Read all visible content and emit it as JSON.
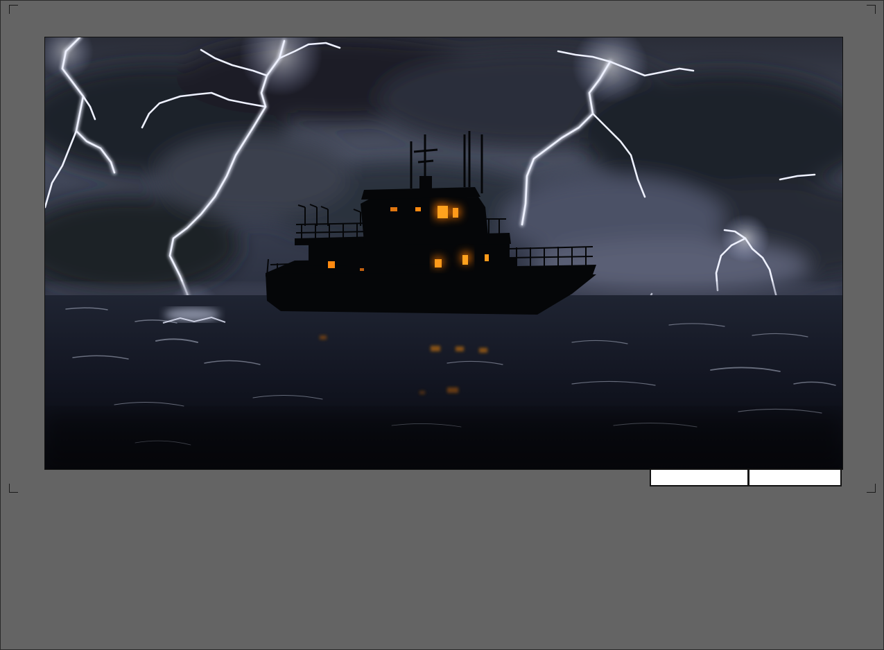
{
  "scene": {
    "subject": "",
    "sky_color": "#3c4252",
    "cloud_color": "#232633",
    "sea_color": "#141824",
    "lightning_color": "#e8ecff",
    "window_glow": "#ff9a1a"
  },
  "caption_boxes": [
    {
      "text": ""
    },
    {
      "text": ""
    }
  ]
}
